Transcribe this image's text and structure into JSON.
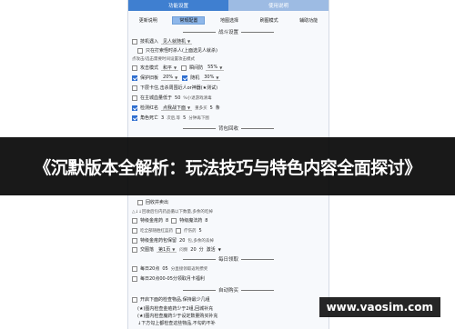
{
  "window_tabs": [
    "功能设置",
    "使用说明"
  ],
  "sub_tabs": [
    "更新说明",
    "常规配置",
    "地图选择",
    "刷图模式",
    "辅助功能"
  ],
  "sections": {
    "battle": "战斗设置",
    "bag": "背包回收",
    "daily": "每日领取",
    "auto_buy": "自动购买"
  },
  "rows": {
    "r1": {
      "label": "技机遇入",
      "select": "见人就随机"
    },
    "r2": {
      "label": "只在打索怪时杀人(上面选见人就杀)"
    },
    "r3": {
      "note": "点攻击/选击需要时间设置攻击模式"
    },
    "r4": {
      "label": "攻击模式",
      "select": "和平",
      "label2": "瞬间防",
      "value2": "55%"
    },
    "r5": {
      "label": "保护旧板",
      "value": "20%",
      "label2": "随机",
      "value2": "30%"
    },
    "r6": {
      "label": "下层卡住,击杀周围近人or神器(★测试)"
    },
    "r7": {
      "label": "在主城血量低于",
      "value": "50",
      "note": "%小退游戏清毒"
    },
    "r8": {
      "label": "检测红名",
      "select": "点我战下面",
      "label2": "重多买",
      "value2": "5",
      "unit": "条"
    },
    "r9": {
      "label": "角色死亡",
      "value": "3",
      "label2": "次后,等",
      "value2": "5",
      "unit": "分钟再下图"
    },
    "r10": {
      "label": "回收并卖出"
    },
    "r11": {
      "note": "△↓↓回收后包内药品循以下数量,多余的吃掉"
    },
    "r12": {
      "label": "特级金疮药",
      "value": "8",
      "label2": "特级魔法药",
      "value2": "8"
    },
    "r13": {
      "label": "吃全部随胜红蓝药",
      "label2": "疗伤药",
      "value2": "5"
    },
    "r14": {
      "label": "特级金疮药包保留",
      "value": "20",
      "note": "包,多余的丢掉"
    },
    "r15": {
      "label": "交图落",
      "select": "第1页",
      "label2": "问频",
      "value2": "20",
      "unit": "分",
      "tail": "激活"
    },
    "r16": {
      "label": "每日20点",
      "value": "05",
      "note": "分直接领取返利攒奖"
    },
    "r17": {
      "label": "每日20点00-05分领取月卡福利"
    },
    "r18": {
      "label": "开启下面的检查物品,保持最少几组"
    },
    "r19": {
      "note": "(★)图内检查金疮药少于2组,回城补充"
    },
    "r20": {
      "note": "(★)图内检查魔药少于设定数量购买补充"
    },
    "r21": {
      "note": "↓下方勾上都检查这些物品,不勾的不补"
    }
  },
  "ribbon_text": "《沉默版本全解析：玩法技巧与特色内容全面探讨》",
  "watermark": "www.vaosim.com"
}
